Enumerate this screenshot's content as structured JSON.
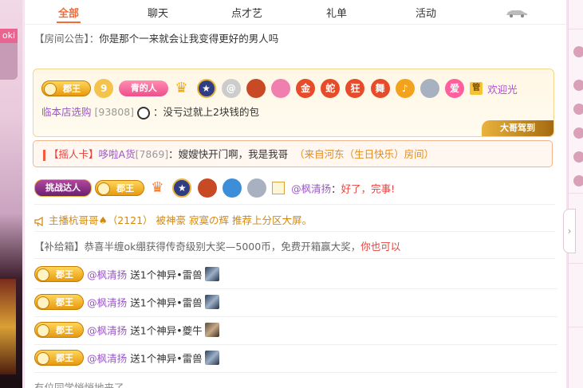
{
  "tabs": [
    "全部",
    "聊天",
    "点才艺",
    "礼单",
    "活动"
  ],
  "left_strip_chip": "oki",
  "notice": {
    "tag": "【房间公告】：",
    "text": "你是那个一来就会让我变得更好的男人吗"
  },
  "vip": {
    "badge_level": "郡王",
    "fan_badge": "青的人",
    "medals": [
      "金",
      "蛇",
      "狂",
      "舞"
    ],
    "love": "爱",
    "guan": "管",
    "welcome": "欢迎光",
    "name": "临本店选购",
    "uid": "[93808]",
    "message": "没亏过就上2块钱的包",
    "arrive": "大哥驾到"
  },
  "card": {
    "tag": "【摇人卡】",
    "name": "哆啦A货",
    "uid": "[7869]",
    "message": "嫂嫂快开门啊，我是我哥",
    "from": "（来自河东（生日快乐）房间）"
  },
  "reply": {
    "badge1": "挑战达人",
    "badge_level": "郡王",
    "mention": "@枫清扬",
    "message": "好了，完事!"
  },
  "system": {
    "icon": "megaphone-icon",
    "text": "主播杭哥哥♠（2121） 被神豪 寂寞の辉 推荐上分区大屏。"
  },
  "bonus": {
    "text": "【补给箱】恭喜半缠ok绷获得传奇级别大奖—5000币，免费开箱赢大奖，",
    "link": "你也可以"
  },
  "gifts": [
    {
      "badge": "郡王",
      "user": "@枫清扬",
      "text": "送1个神异•雷兽"
    },
    {
      "badge": "郡王",
      "user": "@枫清扬",
      "text": "送1个神异•雷兽"
    },
    {
      "badge": "郡王",
      "user": "@枫清扬",
      "text": "送1个神异•夔牛"
    },
    {
      "badge": "郡王",
      "user": "@枫清扬",
      "text": "送1个神异•雷兽"
    }
  ],
  "bottom_text": "有位同学悄悄地来了"
}
